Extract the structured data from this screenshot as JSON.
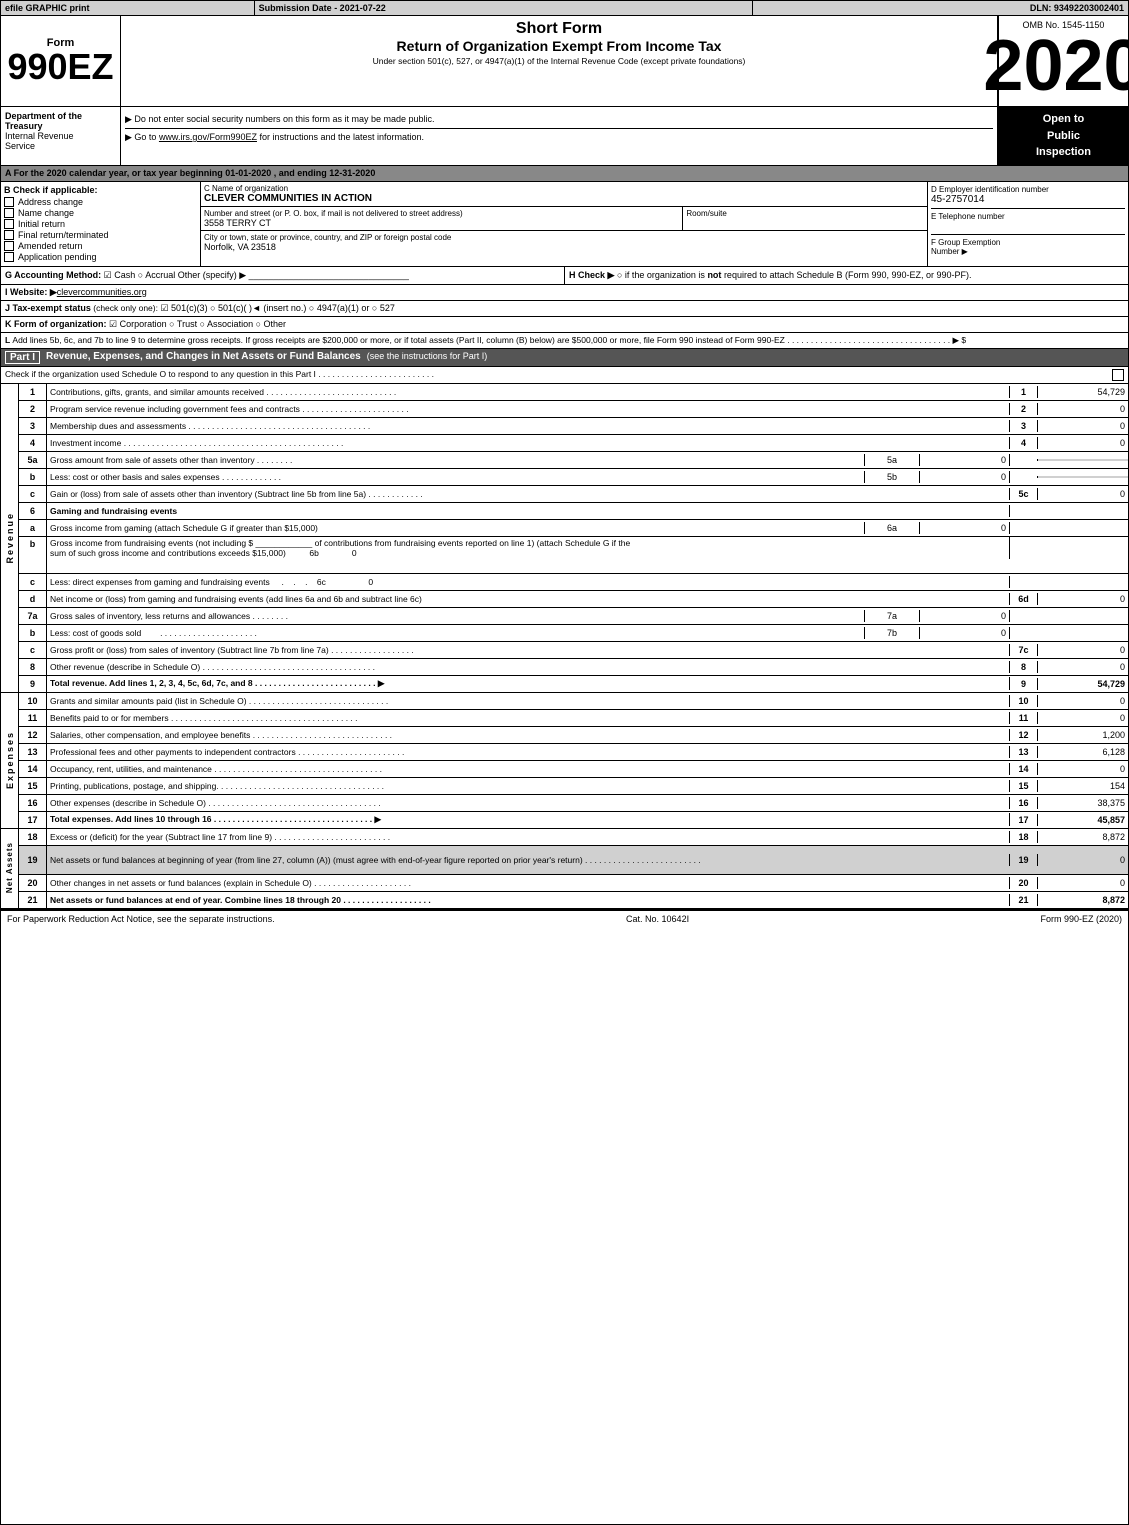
{
  "header": {
    "efile_label": "efile GRAPHIC print",
    "submission_label": "Submission Date - 2021-07-22",
    "dln_label": "DLN: 93492203002401",
    "form_number": "990EZ",
    "form_title_line1": "Short Form",
    "form_title_line2": "Return of Organization Exempt From Income Tax",
    "form_subtitle": "Under section 501(c), 527, or 4947(a)(1) of the Internal Revenue Code (except private foundations)",
    "omb_label": "OMB No. 1545-1150",
    "year": "2020",
    "instruction1": "▶ Do not enter social security numbers on this form as it may be made public.",
    "instruction2": "▶ Go to www.irs.gov/Form990EZ for instructions and the latest information.",
    "open_to_public": "Open to\nPublic\nInspection"
  },
  "dept": {
    "name": "Department of the Treasury",
    "sub": "Internal Revenue Service"
  },
  "article_a": {
    "text": "A  For the 2020 calendar year, or tax year beginning 01-01-2020 , and ending 12-31-2020"
  },
  "section_b": {
    "label": "B Check if applicable:",
    "items": [
      {
        "id": "address_change",
        "label": "Address change",
        "checked": false
      },
      {
        "id": "name_change",
        "label": "Name change",
        "checked": false
      },
      {
        "id": "initial_return",
        "label": "Initial return",
        "checked": false
      },
      {
        "id": "final_return",
        "label": "Final return/terminated",
        "checked": false
      },
      {
        "id": "amended_return",
        "label": "Amended return",
        "checked": false
      },
      {
        "id": "application_pending",
        "label": "Application pending",
        "checked": false
      }
    ]
  },
  "org": {
    "c_label": "C Name of organization",
    "name": "CLEVER COMMUNITIES IN ACTION",
    "address_label": "Number and street (or P. O. box, if mail is not delivered to street address)",
    "address": "3558 TERRY CT",
    "room_label": "Room/suite",
    "room": "",
    "city_label": "City or town, state or province, country, and ZIP or foreign postal code",
    "city": "Norfolk, VA  23518",
    "d_label": "D Employer identification number",
    "ein": "45-2757014",
    "e_label": "E Telephone number",
    "phone": "",
    "f_label": "F Group Exemption Number",
    "group_num": ""
  },
  "section_g": {
    "label": "G Accounting Method:",
    "cash_label": "Cash",
    "accrual_label": "Accrual",
    "other_label": "Other (specify) ▶",
    "cash_checked": true,
    "accrual_checked": false
  },
  "section_h": {
    "label": "H  Check ▶",
    "text": "○ if the organization is not required to attach Schedule B (Form 990, 990-EZ, or 990-PF)."
  },
  "section_i": {
    "label": "I Website: ▶clevercommunities.org"
  },
  "section_j": {
    "label": "J Tax-exempt status (check only one):",
    "options": "☑ 501(c)(3)  ○ 501(c)(  )◄ (insert no.)  ○ 4947(a)(1) or  ○ 527"
  },
  "section_k": {
    "label": "K Form of organization:",
    "corporation": "☑ Corporation",
    "trust": "○ Trust",
    "association": "○ Association",
    "other": "○ Other"
  },
  "section_l": {
    "text": "L Add lines 5b, 6c, and 7b to line 9 to determine gross receipts. If gross receipts are $200,000 or more, or if total assets (Part II, column (B) below) are $500,000 or more, file Form 990 instead of Form 990-EZ . . . . . . . . . . . . . . . . . . . . . . . . . . . . . . . . . . . ▶ $"
  },
  "part1": {
    "header": "Part I",
    "title": "Revenue, Expenses, and Changes in Net Assets or Fund Balances",
    "subtitle": "(see the instructions for Part I)",
    "check_note": "Check if the organization used Schedule O to respond to any question in this Part I . . . . . . . . . . . . . . . . . . . . . . . . .",
    "rows": [
      {
        "num": "1",
        "desc": "Contributions, gifts, grants, and similar amounts received . . . . . . . . . . . . . . . . . .",
        "linenum": "1",
        "value": "54,729"
      },
      {
        "num": "2",
        "desc": "Program service revenue including government fees and contracts . . . . . . . . . . . . . . .",
        "linenum": "2",
        "value": "0"
      },
      {
        "num": "3",
        "desc": "Membership dues and assessments . . . . . . . . . . . . . . . . . . . . . . . . . . . . . .",
        "linenum": "3",
        "value": "0"
      },
      {
        "num": "4",
        "desc": "Investment income . . . . . . . . . . . . . . . . . . . . . . . . . . . . . . . . . . . . . .",
        "linenum": "4",
        "value": "0"
      }
    ],
    "row5a": {
      "num": "5a",
      "desc": "Gross amount from sale of assets other than inventory . . . . . . . .",
      "ref": "5a",
      "midval": "0"
    },
    "row5b": {
      "num": "b",
      "desc": "Less: cost or other basis and sales expenses . . . . . . . . . . . . .",
      "ref": "5b",
      "midval": "0"
    },
    "row5c": {
      "num": "c",
      "desc": "Gain or (loss) from sale of assets other than inventory (Subtract line 5b from line 5a) . . . . . .",
      "linenum": "5c",
      "value": "0"
    },
    "row6_header": {
      "num": "6",
      "desc": "Gaming and fundraising events"
    },
    "row6a": {
      "num": "a",
      "desc": "Gross income from gaming (attach Schedule G if greater than $15,000)",
      "ref": "6a",
      "midval": "0"
    },
    "row6b_desc": {
      "num": "b",
      "desc": "Gross income from fundraising events (not including $__________ of contributions from fundraising events reported on line 1) (attach Schedule G if the sum of such gross income and contributions exceeds $15,000)",
      "ref": "6b",
      "midval": "0"
    },
    "row6c": {
      "num": "c",
      "desc": "Less: direct expenses from gaming and fundraising events . . . .",
      "ref": "6c",
      "midval": "0"
    },
    "row6d": {
      "num": "d",
      "desc": "Net income or (loss) from gaming and fundraising events (add lines 6a and 6b and subtract line 6c)",
      "linenum": "6d",
      "value": "0"
    },
    "row7a": {
      "num": "7a",
      "desc": "Gross sales of inventory, less returns and allowances . . . . . . . .",
      "ref": "7a",
      "midval": "0"
    },
    "row7b": {
      "num": "b",
      "desc": "Less: cost of goods sold     . . . . . . . . . . . . . . . . . . . . . .",
      "ref": "7b",
      "midval": "0"
    },
    "row7c": {
      "num": "c",
      "desc": "Gross profit or (loss) from sales of inventory (Subtract line 7b from line 7a) . . . . . . . . . . .",
      "linenum": "7c",
      "value": "0"
    },
    "row8": {
      "num": "8",
      "desc": "Other revenue (describe in Schedule O) . . . . . . . . . . . . . . . . . . . . . . . . . . . . .",
      "linenum": "8",
      "value": "0"
    },
    "row9": {
      "num": "9",
      "desc": "Total revenue. Add lines 1, 2, 3, 4, 5c, 6d, 7c, and 8 . . . . . . . . . . . . . . . . . . . . ▶",
      "linenum": "9",
      "value": "54,729"
    }
  },
  "expenses": {
    "rows": [
      {
        "num": "10",
        "desc": "Grants and similar amounts paid (list in Schedule O) . . . . . . . . . . . . . . . . . . . . . . .",
        "linenum": "10",
        "value": "0"
      },
      {
        "num": "11",
        "desc": "Benefits paid to or for members  . . . . . . . . . . . . . . . . . . . . . . . . . . . . . . . . .",
        "linenum": "11",
        "value": "0"
      },
      {
        "num": "12",
        "desc": "Salaries, other compensation, and employee benefits . . . . . . . . . . . . . . . . . . . . . . .",
        "linenum": "12",
        "value": "1,200"
      },
      {
        "num": "13",
        "desc": "Professional fees and other payments to independent contractors . . . . . . . . . . . . . . . . .",
        "linenum": "13",
        "value": "6,128"
      },
      {
        "num": "14",
        "desc": "Occupancy, rent, utilities, and maintenance . . . . . . . . . . . . . . . . . . . . . . . . . . . .",
        "linenum": "14",
        "value": "0"
      },
      {
        "num": "15",
        "desc": "Printing, publications, postage, and shipping. . . . . . . . . . . . . . . . . . . . . . . . . . . .",
        "linenum": "15",
        "value": "154"
      },
      {
        "num": "16",
        "desc": "Other expenses (describe in Schedule O) . . . . . . . . . . . . . . . . . . . . . . . . . . . . .",
        "linenum": "16",
        "value": "38,375"
      },
      {
        "num": "17",
        "desc": "Total expenses. Add lines 10 through 16   . . . . . . . . . . . . . . . . . . . . . . . . . . ▶",
        "linenum": "17",
        "value": "45,857"
      }
    ]
  },
  "net_assets": {
    "rows": [
      {
        "num": "18",
        "desc": "Excess or (deficit) for the year (Subtract line 17 from line 9)   . . . . . . . . . . . . . . . . . .",
        "linenum": "18",
        "value": "8,872"
      },
      {
        "num": "19",
        "desc": "Net assets or fund balances at beginning of year (from line 27, column (A)) (must agree with end-of-year figure reported on prior year's return) . . . . . . . . . . . . . . . . . . . . . . . . .",
        "linenum": "19",
        "value": "0",
        "shaded": true
      },
      {
        "num": "20",
        "desc": "Other changes in net assets or fund balances (explain in Schedule O) . . . . . . . . . . . . . .",
        "linenum": "20",
        "value": "0"
      },
      {
        "num": "21",
        "desc": "Net assets or fund balances at end of year. Combine lines 18 through 20 . . . . . . . . . . . .",
        "linenum": "21",
        "value": "8,872"
      }
    ]
  },
  "footer": {
    "left": "For Paperwork Reduction Act Notice, see the separate instructions.",
    "cat": "Cat. No. 10642I",
    "right": "Form 990-EZ (2020)"
  }
}
